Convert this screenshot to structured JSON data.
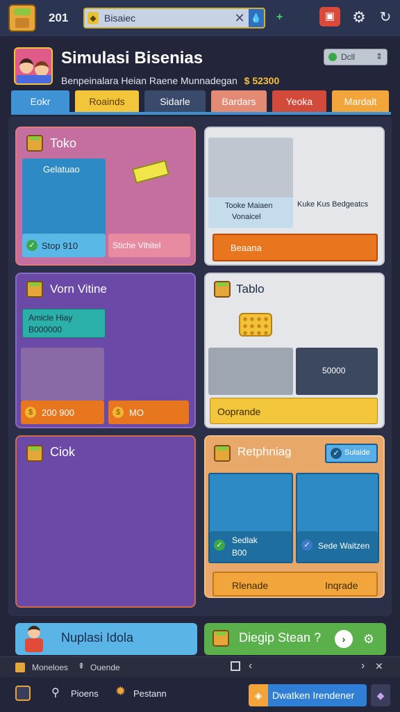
{
  "topbar": {
    "counter": "201",
    "search_value": "Bisaiec",
    "search_icon": "tag-icon",
    "clear_icon": "close-icon",
    "dropdown_icon": "drop-icon",
    "plus_icon": "plus-icon",
    "gift_icon": "gift-icon",
    "settings_icon": "gear-icon",
    "sync_icon": "sync-icon"
  },
  "header": {
    "title": "Simulasi Bisenias",
    "subtitle": "Benpeinalara Heian Raene Munnadegan",
    "money": "$ 52300",
    "reset_label": "Dcll"
  },
  "tabs": [
    {
      "label": "Eokr",
      "color": "#3f92d4",
      "text": "#ffffff"
    },
    {
      "label": "Roainds",
      "color": "#f2c53a",
      "text": "#5a3c00"
    },
    {
      "label": "Sidarle",
      "color": "#3a4a6a",
      "text": "#ffffff"
    },
    {
      "label": "Bardars",
      "color": "#e38a74",
      "text": "#ffffff"
    },
    {
      "label": "Yeoka",
      "color": "#d24a3a",
      "text": "#ffffff"
    },
    {
      "label": "Mardalt",
      "color": "#f2a53a",
      "text": "#ffffff"
    }
  ],
  "cards": {
    "toko": {
      "title": "Toko",
      "tile_label": "Gelatuao",
      "price_pill": "Stop 910",
      "side_label": "Stiche Vlhitel"
    },
    "shop_upgrade": {
      "tile_caption_1": "Tooke Maiaen",
      "tile_caption_2": "Vonaicel",
      "side_label": "Kuke Kus Bedgeatcs",
      "action_label": "Beaana"
    },
    "vorn": {
      "title": "Vorn Vitine",
      "info_line_1": "Amicle Hiay",
      "info_line_2": "B000000",
      "price_left": "200 900",
      "price_right": "MO"
    },
    "tabla": {
      "title": "Tablo",
      "stock_value": "50000",
      "action_label": "Ooprande"
    },
    "ciok": {
      "title": "Ciok"
    },
    "refining": {
      "title": "Retphniag",
      "badge_label": "Sulaide",
      "tile_left_line_1": "Sedlak",
      "tile_left_line_2": "B00",
      "tile_right_label": "Sede Waitzen",
      "btn_left": "Rlenade",
      "btn_right": "Inqrade"
    }
  },
  "features": {
    "left_label": "Nuplasi Idola",
    "right_label": "Diegip Stean ?"
  },
  "statusbar": {
    "left_item": "Moneloes",
    "mid_item": "Ouende"
  },
  "bottomnav": {
    "item_1": "Pioens",
    "item_2": "Pestann",
    "cta_label": "Dwatken Irendener"
  }
}
